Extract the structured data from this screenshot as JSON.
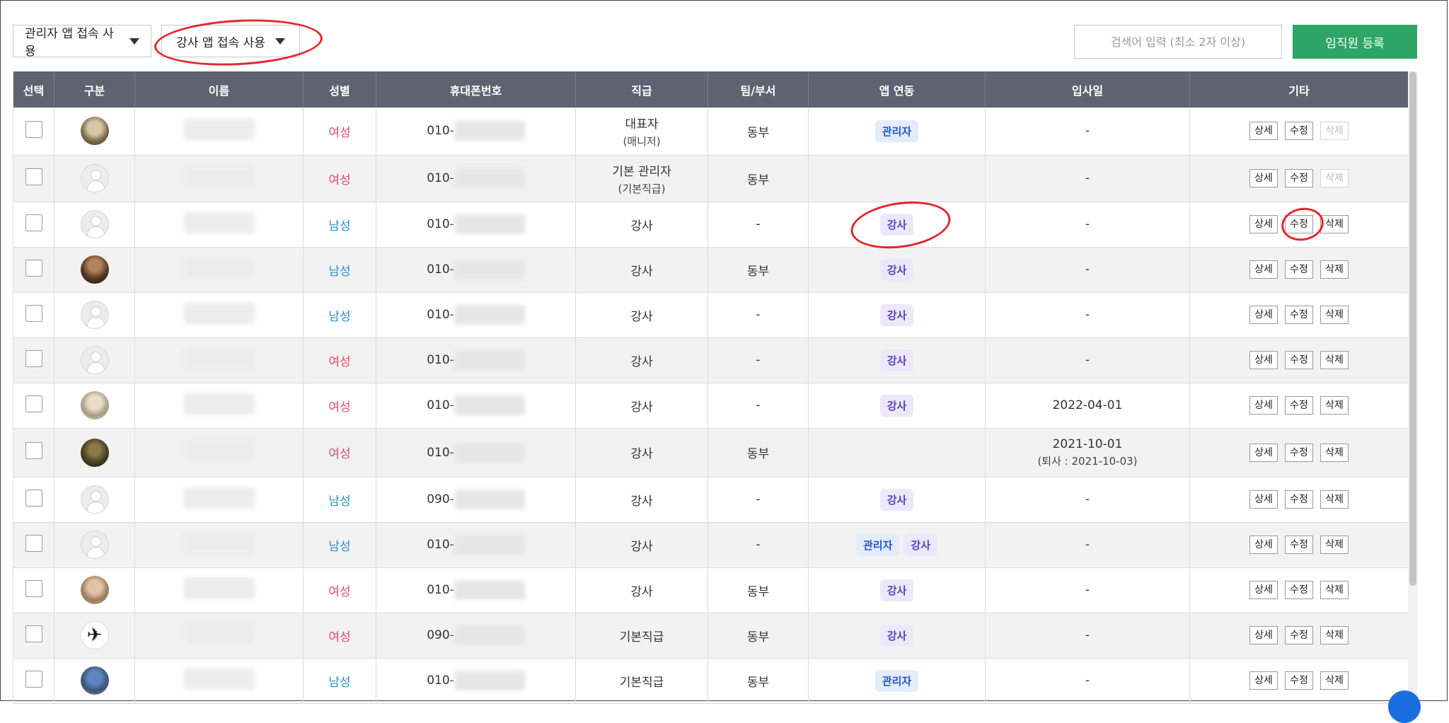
{
  "toolbar": {
    "filter_admin_label": "관리자 앱 접속 사용",
    "filter_instructor_label": "강사 앱 접속 사용",
    "search_placeholder": "검색어 입력 (최소 2자 이상)",
    "register_label": "임직원 등록"
  },
  "table": {
    "headers": [
      "선택",
      "구분",
      "이름",
      "성별",
      "휴대폰번호",
      "직급",
      "팀/부서",
      "앱 연동",
      "입사일",
      "기타"
    ],
    "action_labels": {
      "detail": "상세",
      "edit": "수정",
      "delete": "삭제"
    },
    "rows": [
      {
        "gender": "여성",
        "phone_prefix": "010-",
        "rank": "대표자",
        "rank_sub": "(매니저)",
        "dept": "동부",
        "app_badges": [
          "관리자"
        ],
        "join_date": "-",
        "join_sub": ""
      },
      {
        "gender": "여성",
        "phone_prefix": "010-",
        "rank": "기본 관리자",
        "rank_sub": "(기본직급)",
        "dept": "동부",
        "app_badges": [],
        "join_date": "-",
        "join_sub": ""
      },
      {
        "gender": "남성",
        "phone_prefix": "010-",
        "rank": "강사",
        "rank_sub": "",
        "dept": "-",
        "app_badges": [
          "강사"
        ],
        "join_date": "-",
        "join_sub": ""
      },
      {
        "gender": "남성",
        "phone_prefix": "010-",
        "rank": "강사",
        "rank_sub": "",
        "dept": "동부",
        "app_badges": [
          "강사"
        ],
        "join_date": "-",
        "join_sub": ""
      },
      {
        "gender": "남성",
        "phone_prefix": "010-",
        "rank": "강사",
        "rank_sub": "",
        "dept": "-",
        "app_badges": [
          "강사"
        ],
        "join_date": "-",
        "join_sub": ""
      },
      {
        "gender": "여성",
        "phone_prefix": "010-",
        "rank": "강사",
        "rank_sub": "",
        "dept": "-",
        "app_badges": [
          "강사"
        ],
        "join_date": "-",
        "join_sub": ""
      },
      {
        "gender": "여성",
        "phone_prefix": "010-",
        "rank": "강사",
        "rank_sub": "",
        "dept": "-",
        "app_badges": [
          "강사"
        ],
        "join_date": "2022-04-01",
        "join_sub": ""
      },
      {
        "gender": "여성",
        "phone_prefix": "010-",
        "rank": "강사",
        "rank_sub": "",
        "dept": "동부",
        "app_badges": [],
        "join_date": "2021-10-01",
        "join_sub": "(퇴사 : 2021-10-03)"
      },
      {
        "gender": "남성",
        "phone_prefix": "090-",
        "rank": "강사",
        "rank_sub": "",
        "dept": "-",
        "app_badges": [
          "강사"
        ],
        "join_date": "-",
        "join_sub": ""
      },
      {
        "gender": "남성",
        "phone_prefix": "010-",
        "rank": "강사",
        "rank_sub": "",
        "dept": "-",
        "app_badges": [
          "관리자",
          "강사"
        ],
        "join_date": "-",
        "join_sub": ""
      },
      {
        "gender": "여성",
        "phone_prefix": "010-",
        "rank": "강사",
        "rank_sub": "",
        "dept": "동부",
        "app_badges": [
          "강사"
        ],
        "join_date": "-",
        "join_sub": ""
      },
      {
        "gender": "여성",
        "phone_prefix": "090-",
        "rank": "기본직급",
        "rank_sub": "",
        "dept": "동부",
        "app_badges": [
          "강사"
        ],
        "join_date": "-",
        "join_sub": ""
      },
      {
        "gender": "남성",
        "phone_prefix": "010-",
        "rank": "기본직급",
        "rank_sub": "",
        "dept": "동부",
        "app_badges": [
          "관리자"
        ],
        "join_date": "-",
        "join_sub": ""
      }
    ]
  },
  "colors": {
    "header_bg": "#5f6270",
    "register_bg": "#2ea565",
    "female": "#e2496a",
    "male": "#2b8fc7",
    "annotation": "#e4262f"
  }
}
